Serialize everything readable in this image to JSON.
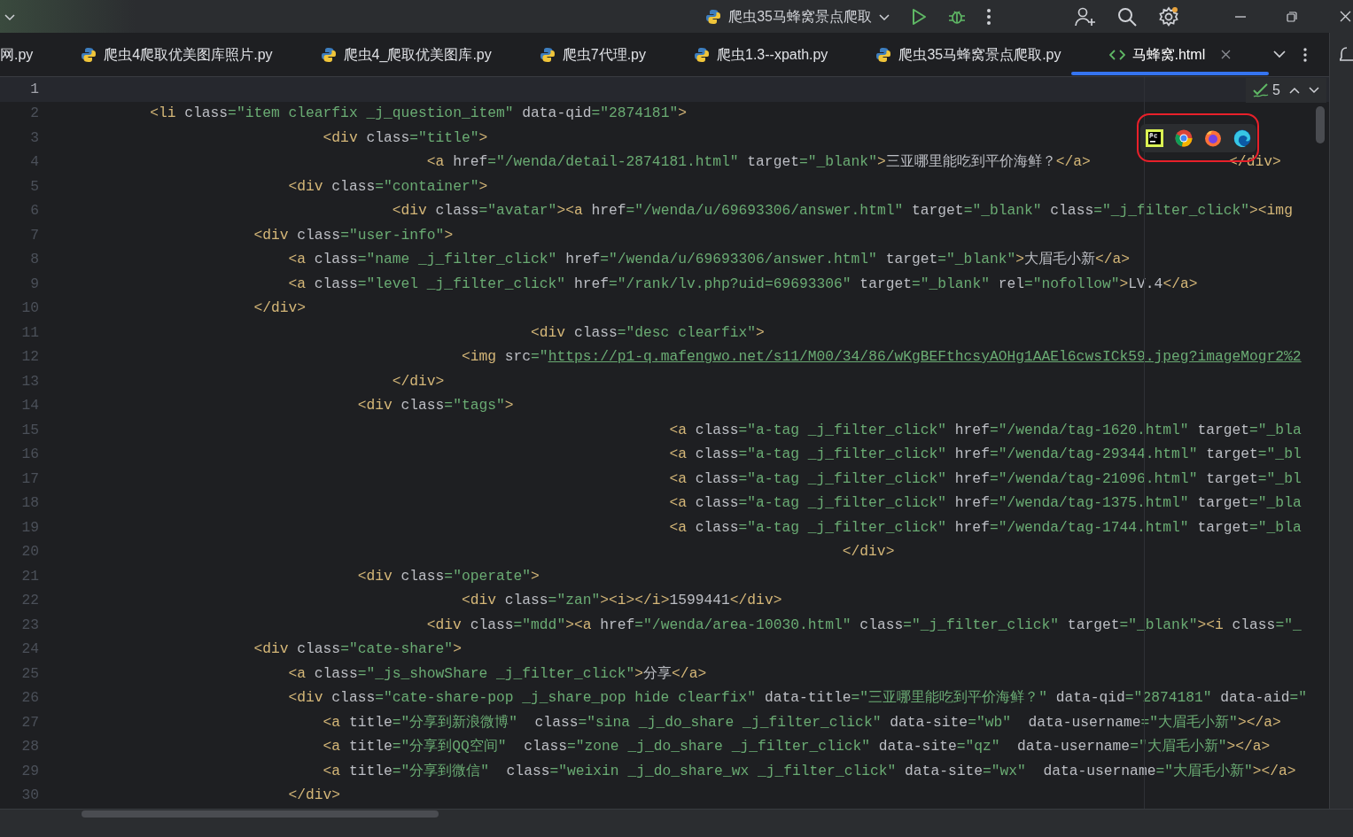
{
  "title_bar": {
    "run_configuration": "爬虫35马蜂窝景点爬取"
  },
  "tabs": [
    {
      "label": "网.py",
      "kind": "cut",
      "selected": false
    },
    {
      "label": "爬虫4爬取优美图库照片.py",
      "kind": "python",
      "selected": false
    },
    {
      "label": "爬虫4_爬取优美图库.py",
      "kind": "python",
      "selected": false
    },
    {
      "label": "爬虫7代理.py",
      "kind": "python",
      "selected": false
    },
    {
      "label": "爬虫1.3--xpath.py",
      "kind": "python",
      "selected": false
    },
    {
      "label": "爬虫35马蜂窝景点爬取.py",
      "kind": "python",
      "selected": false
    },
    {
      "label": "马蜂窝.html",
      "kind": "html",
      "selected": true
    }
  ],
  "inspections": {
    "count": "5"
  },
  "editor": {
    "lines": [
      {
        "number": "1",
        "current": true
      },
      {
        "number": "2",
        "current": false,
        "tokens": [
          {
            "kind": "tag",
            "text": "        <li"
          },
          {
            "kind": "attr",
            "text": " class"
          },
          {
            "kind": "value",
            "text": "=\"item clearfix _j_question_item\""
          },
          {
            "kind": "attr",
            "text": " data-qid"
          },
          {
            "kind": "value",
            "text": "=\"2874181\""
          },
          {
            "kind": "tag",
            "text": ">"
          }
        ]
      },
      {
        "number": "3",
        "current": false,
        "tokens": [
          {
            "kind": "tag",
            "text": "                            <div"
          },
          {
            "kind": "attr",
            "text": " class"
          },
          {
            "kind": "value",
            "text": "=\"title\""
          },
          {
            "kind": "tag",
            "text": ">"
          }
        ]
      },
      {
        "number": "4",
        "current": false,
        "tokens": [
          {
            "kind": "tag",
            "text": "                                        <a"
          },
          {
            "kind": "attr",
            "text": " href"
          },
          {
            "kind": "value",
            "text": "=\"/wenda/detail-2874181.html\""
          },
          {
            "kind": "attr",
            "text": " target"
          },
          {
            "kind": "value",
            "text": "=\"_blank\""
          },
          {
            "kind": "tag",
            "text": ">"
          },
          {
            "kind": "text",
            "text": "三亚哪里能吃到平价海鲜？"
          },
          {
            "kind": "tag",
            "text": "</a>                </div>"
          }
        ]
      },
      {
        "number": "5",
        "current": false,
        "tokens": [
          {
            "kind": "tag",
            "text": "                        <div"
          },
          {
            "kind": "attr",
            "text": " class"
          },
          {
            "kind": "value",
            "text": "=\"container\""
          },
          {
            "kind": "tag",
            "text": ">"
          }
        ]
      },
      {
        "number": "6",
        "current": false,
        "tokens": [
          {
            "kind": "tag",
            "text": "                                    <div"
          },
          {
            "kind": "attr",
            "text": " class"
          },
          {
            "kind": "value",
            "text": "=\"avatar\""
          },
          {
            "kind": "tag",
            "text": "><a"
          },
          {
            "kind": "attr",
            "text": " href"
          },
          {
            "kind": "value",
            "text": "=\"/wenda/u/69693306/answer.html\""
          },
          {
            "kind": "attr",
            "text": " target"
          },
          {
            "kind": "value",
            "text": "=\"_blank\""
          },
          {
            "kind": "attr",
            "text": " class"
          },
          {
            "kind": "value",
            "text": "=\"_j_filter_click\""
          },
          {
            "kind": "tag",
            "text": "><img"
          }
        ]
      },
      {
        "number": "7",
        "current": false,
        "tokens": [
          {
            "kind": "tag",
            "text": "                    <div"
          },
          {
            "kind": "attr",
            "text": " class"
          },
          {
            "kind": "value",
            "text": "=\"user-info\""
          },
          {
            "kind": "tag",
            "text": ">"
          }
        ]
      },
      {
        "number": "8",
        "current": false,
        "tokens": [
          {
            "kind": "tag",
            "text": "                        <a"
          },
          {
            "kind": "attr",
            "text": " class"
          },
          {
            "kind": "value",
            "text": "=\"name _j_filter_click\""
          },
          {
            "kind": "attr",
            "text": " href"
          },
          {
            "kind": "value",
            "text": "=\"/wenda/u/69693306/answer.html\""
          },
          {
            "kind": "attr",
            "text": " target"
          },
          {
            "kind": "value",
            "text": "=\"_blank\""
          },
          {
            "kind": "tag",
            "text": ">"
          },
          {
            "kind": "text",
            "text": "大眉毛小新"
          },
          {
            "kind": "tag",
            "text": "</a>"
          }
        ]
      },
      {
        "number": "9",
        "current": false,
        "tokens": [
          {
            "kind": "tag",
            "text": "                        <a"
          },
          {
            "kind": "attr",
            "text": " class"
          },
          {
            "kind": "value",
            "text": "=\"level _j_filter_click\""
          },
          {
            "kind": "attr",
            "text": " href"
          },
          {
            "kind": "value",
            "text": "=\"/rank/lv.php?uid=69693306\""
          },
          {
            "kind": "attr",
            "text": " target"
          },
          {
            "kind": "value",
            "text": "=\"_blank\""
          },
          {
            "kind": "attr",
            "text": " rel"
          },
          {
            "kind": "value",
            "text": "=\"nofollow\""
          },
          {
            "kind": "tag",
            "text": ">"
          },
          {
            "kind": "text",
            "text": "LV.4"
          },
          {
            "kind": "tag",
            "text": "</a>"
          }
        ]
      },
      {
        "number": "10",
        "current": false,
        "tokens": [
          {
            "kind": "tag",
            "text": "                    </div>"
          }
        ]
      },
      {
        "number": "11",
        "current": false,
        "tokens": [
          {
            "kind": "tag",
            "text": "                                                    <div"
          },
          {
            "kind": "attr",
            "text": " class"
          },
          {
            "kind": "value",
            "text": "=\"desc clearfix\""
          },
          {
            "kind": "tag",
            "text": ">"
          }
        ]
      },
      {
        "number": "12",
        "current": false,
        "tokens": [
          {
            "kind": "tag",
            "text": "                                            <img"
          },
          {
            "kind": "attr",
            "text": " src"
          },
          {
            "kind": "value",
            "text": "=\""
          },
          {
            "kind": "link",
            "text": "https://p1-q.mafengwo.net/s11/M00/34/86/wKgBEFthcsyAOHg1AAEl6cwsICk59.jpeg?imageMogr2%2"
          }
        ]
      },
      {
        "number": "13",
        "current": false,
        "tokens": [
          {
            "kind": "tag",
            "text": "                                    </div>"
          }
        ]
      },
      {
        "number": "14",
        "current": false,
        "tokens": [
          {
            "kind": "tag",
            "text": "                                <div"
          },
          {
            "kind": "attr",
            "text": " class"
          },
          {
            "kind": "value",
            "text": "=\"tags\""
          },
          {
            "kind": "tag",
            "text": ">"
          }
        ]
      },
      {
        "number": "15",
        "current": false,
        "tokens": [
          {
            "kind": "tag",
            "text": "                                                                    <a"
          },
          {
            "kind": "attr",
            "text": " class"
          },
          {
            "kind": "value",
            "text": "=\"a-tag _j_filter_click\""
          },
          {
            "kind": "attr",
            "text": " href"
          },
          {
            "kind": "value",
            "text": "=\"/wenda/tag-1620.html\""
          },
          {
            "kind": "attr",
            "text": " target"
          },
          {
            "kind": "value",
            "text": "=\"_bla"
          }
        ]
      },
      {
        "number": "16",
        "current": false,
        "tokens": [
          {
            "kind": "tag",
            "text": "                                                                    <a"
          },
          {
            "kind": "attr",
            "text": " class"
          },
          {
            "kind": "value",
            "text": "=\"a-tag _j_filter_click\""
          },
          {
            "kind": "attr",
            "text": " href"
          },
          {
            "kind": "value",
            "text": "=\"/wenda/tag-29344.html\""
          },
          {
            "kind": "attr",
            "text": " target"
          },
          {
            "kind": "value",
            "text": "=\"_bl"
          }
        ]
      },
      {
        "number": "17",
        "current": false,
        "tokens": [
          {
            "kind": "tag",
            "text": "                                                                    <a"
          },
          {
            "kind": "attr",
            "text": " class"
          },
          {
            "kind": "value",
            "text": "=\"a-tag _j_filter_click\""
          },
          {
            "kind": "attr",
            "text": " href"
          },
          {
            "kind": "value",
            "text": "=\"/wenda/tag-21096.html\""
          },
          {
            "kind": "attr",
            "text": " target"
          },
          {
            "kind": "value",
            "text": "=\"_bl"
          }
        ]
      },
      {
        "number": "18",
        "current": false,
        "tokens": [
          {
            "kind": "tag",
            "text": "                                                                    <a"
          },
          {
            "kind": "attr",
            "text": " class"
          },
          {
            "kind": "value",
            "text": "=\"a-tag _j_filter_click\""
          },
          {
            "kind": "attr",
            "text": " href"
          },
          {
            "kind": "value",
            "text": "=\"/wenda/tag-1375.html\""
          },
          {
            "kind": "attr",
            "text": " target"
          },
          {
            "kind": "value",
            "text": "=\"_bla"
          }
        ]
      },
      {
        "number": "19",
        "current": false,
        "tokens": [
          {
            "kind": "tag",
            "text": "                                                                    <a"
          },
          {
            "kind": "attr",
            "text": " class"
          },
          {
            "kind": "value",
            "text": "=\"a-tag _j_filter_click\""
          },
          {
            "kind": "attr",
            "text": " href"
          },
          {
            "kind": "value",
            "text": "=\"/wenda/tag-1744.html\""
          },
          {
            "kind": "attr",
            "text": " target"
          },
          {
            "kind": "value",
            "text": "=\"_bla"
          }
        ]
      },
      {
        "number": "20",
        "current": false,
        "tokens": [
          {
            "kind": "tag",
            "text": "                                                                                        </div>"
          }
        ]
      },
      {
        "number": "21",
        "current": false,
        "tokens": [
          {
            "kind": "tag",
            "text": "                                <div"
          },
          {
            "kind": "attr",
            "text": " class"
          },
          {
            "kind": "value",
            "text": "=\"operate\""
          },
          {
            "kind": "tag",
            "text": ">"
          }
        ]
      },
      {
        "number": "22",
        "current": false,
        "tokens": [
          {
            "kind": "tag",
            "text": "                                            <div"
          },
          {
            "kind": "attr",
            "text": " class"
          },
          {
            "kind": "value",
            "text": "=\"zan\""
          },
          {
            "kind": "tag",
            "text": "><i></i>"
          },
          {
            "kind": "text",
            "text": "1599441"
          },
          {
            "kind": "tag",
            "text": "</div>"
          }
        ]
      },
      {
        "number": "23",
        "current": false,
        "tokens": [
          {
            "kind": "tag",
            "text": "                                        <div"
          },
          {
            "kind": "attr",
            "text": " class"
          },
          {
            "kind": "value",
            "text": "=\"mdd\""
          },
          {
            "kind": "tag",
            "text": "><a"
          },
          {
            "kind": "attr",
            "text": " href"
          },
          {
            "kind": "value",
            "text": "=\"/wenda/area-10030.html\""
          },
          {
            "kind": "attr",
            "text": " class"
          },
          {
            "kind": "value",
            "text": "=\"_j_filter_click\""
          },
          {
            "kind": "attr",
            "text": " target"
          },
          {
            "kind": "value",
            "text": "=\"_blank\""
          },
          {
            "kind": "tag",
            "text": "><i"
          },
          {
            "kind": "attr",
            "text": " class"
          },
          {
            "kind": "value",
            "text": "=\"_"
          }
        ]
      },
      {
        "number": "24",
        "current": false,
        "tokens": [
          {
            "kind": "tag",
            "text": "                    <div"
          },
          {
            "kind": "attr",
            "text": " class"
          },
          {
            "kind": "value",
            "text": "=\"cate-share\""
          },
          {
            "kind": "tag",
            "text": ">"
          }
        ]
      },
      {
        "number": "25",
        "current": false,
        "tokens": [
          {
            "kind": "tag",
            "text": "                        <a"
          },
          {
            "kind": "attr",
            "text": " class"
          },
          {
            "kind": "value",
            "text": "=\"_js_showShare _j_filter_click\""
          },
          {
            "kind": "tag",
            "text": ">"
          },
          {
            "kind": "text",
            "text": "分享"
          },
          {
            "kind": "tag",
            "text": "</a>"
          }
        ]
      },
      {
        "number": "26",
        "current": false,
        "tokens": [
          {
            "kind": "tag",
            "text": "                        <div"
          },
          {
            "kind": "attr",
            "text": " class"
          },
          {
            "kind": "value",
            "text": "=\"cate-share-pop _j_share_pop hide clearfix\""
          },
          {
            "kind": "attr",
            "text": " data-title"
          },
          {
            "kind": "value",
            "text": "=\"三亚哪里能吃到平价海鲜？\""
          },
          {
            "kind": "attr",
            "text": " data-qid"
          },
          {
            "kind": "value",
            "text": "=\"2874181\""
          },
          {
            "kind": "attr",
            "text": " data-aid"
          },
          {
            "kind": "value",
            "text": "=\""
          }
        ]
      },
      {
        "number": "27",
        "current": false,
        "tokens": [
          {
            "kind": "tag",
            "text": "                            <a"
          },
          {
            "kind": "attr",
            "text": " title"
          },
          {
            "kind": "value",
            "text": "=\"分享到新浪微博\""
          },
          {
            "kind": "attr",
            "text": "  class"
          },
          {
            "kind": "value",
            "text": "=\"sina _j_do_share _j_filter_click\""
          },
          {
            "kind": "attr",
            "text": " data-site"
          },
          {
            "kind": "value",
            "text": "=\"wb\""
          },
          {
            "kind": "attr",
            "text": "  data-username"
          },
          {
            "kind": "value",
            "text": "=\"大眉毛小新\""
          },
          {
            "kind": "tag",
            "text": "></a>"
          }
        ]
      },
      {
        "number": "28",
        "current": false,
        "tokens": [
          {
            "kind": "tag",
            "text": "                            <a"
          },
          {
            "kind": "attr",
            "text": " title"
          },
          {
            "kind": "value",
            "text": "=\"分享到QQ空间\""
          },
          {
            "kind": "attr",
            "text": "  class"
          },
          {
            "kind": "value",
            "text": "=\"zone _j_do_share _j_filter_click\""
          },
          {
            "kind": "attr",
            "text": " data-site"
          },
          {
            "kind": "value",
            "text": "=\"qz\""
          },
          {
            "kind": "attr",
            "text": "  data-username"
          },
          {
            "kind": "value",
            "text": "=\"大眉毛小新\""
          },
          {
            "kind": "tag",
            "text": "></a>"
          }
        ]
      },
      {
        "number": "29",
        "current": false,
        "tokens": [
          {
            "kind": "tag",
            "text": "                            <a"
          },
          {
            "kind": "attr",
            "text": " title"
          },
          {
            "kind": "value",
            "text": "=\"分享到微信\""
          },
          {
            "kind": "attr",
            "text": "  class"
          },
          {
            "kind": "value",
            "text": "=\"weixin _j_do_share_wx _j_filter_click\""
          },
          {
            "kind": "attr",
            "text": " data-site"
          },
          {
            "kind": "value",
            "text": "=\"wx\""
          },
          {
            "kind": "attr",
            "text": "  data-username"
          },
          {
            "kind": "value",
            "text": "=\"大眉毛小新\""
          },
          {
            "kind": "tag",
            "text": "></a>"
          }
        ]
      },
      {
        "number": "30",
        "current": false,
        "tokens": [
          {
            "kind": "tag",
            "text": "                        </div>"
          }
        ]
      }
    ]
  }
}
